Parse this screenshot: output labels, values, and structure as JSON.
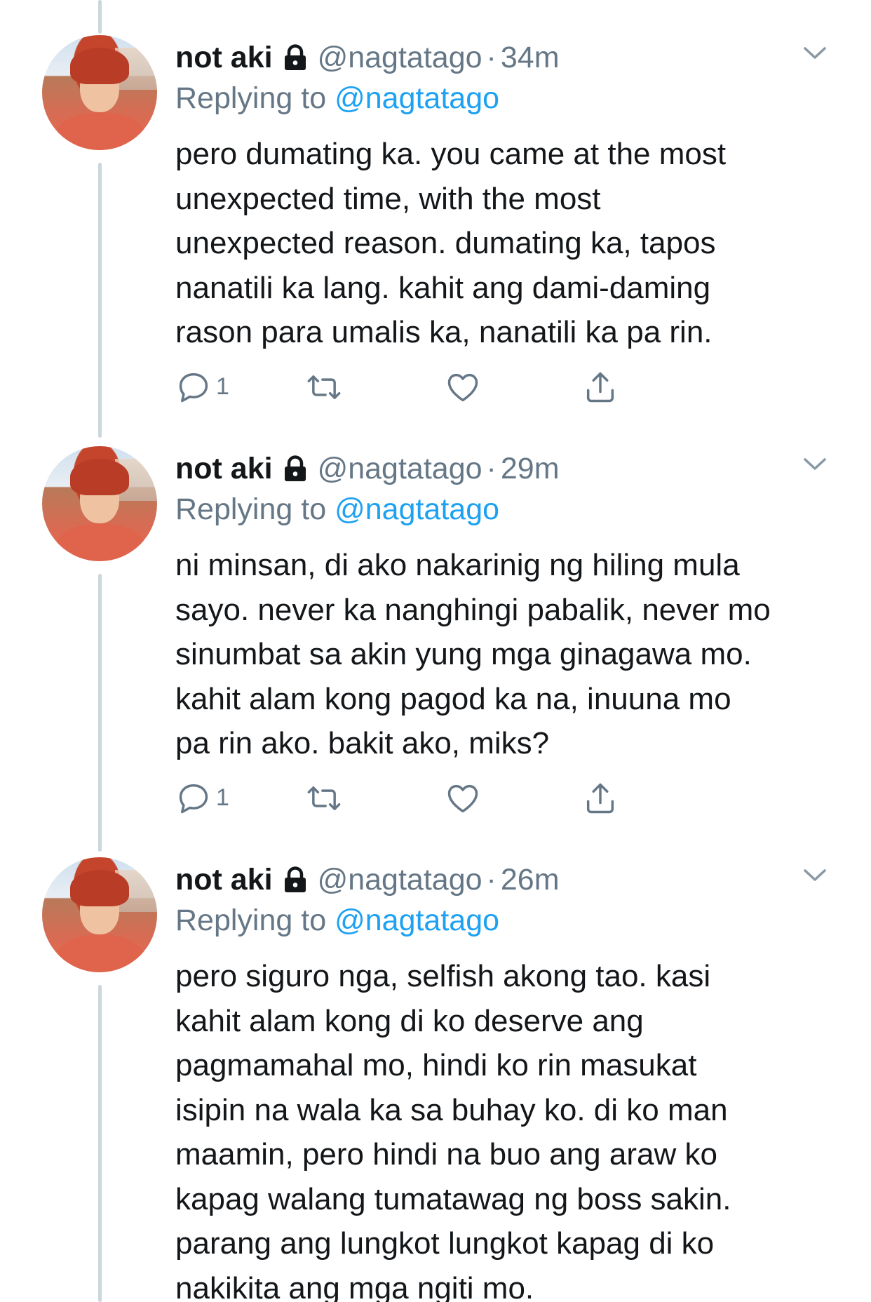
{
  "tweets": [
    {
      "name": "not aki",
      "handle": "@nagtatago",
      "separator": "·",
      "time": "34m",
      "reply_prefix": "Replying to",
      "reply_to": "@nagtatago",
      "text": "pero dumating ka. you came at the most\nunexpected time, with the most\nunexpected reason. dumating ka, tapos\nnanatili ka lang. kahit ang dami-daming\nrason para umalis ka, nanatili ka pa rin.",
      "reply_count": "1"
    },
    {
      "name": "not aki",
      "handle": "@nagtatago",
      "separator": "·",
      "time": "29m",
      "reply_prefix": "Replying to",
      "reply_to": "@nagtatago",
      "text": "ni minsan, di ako nakarinig ng hiling mula\nsayo. never ka nanghingi pabalik, never mo\nsinumbat sa akin yung mga ginagawa mo.\nkahit alam kong pagod ka na, inuuna mo\npa rin ako. bakit ako, miks?",
      "reply_count": "1"
    },
    {
      "name": "not aki",
      "handle": "@nagtatago",
      "separator": "·",
      "time": "26m",
      "reply_prefix": "Replying to",
      "reply_to": "@nagtatago",
      "text": "pero siguro nga, selfish akong tao. kasi\nkahit alam kong di ko deserve ang\npagmamahal mo, hindi ko rin masukat\nisipin na wala ka sa buhay ko. di ko man\nmaamin, pero hindi na buo ang araw ko\nkapag walang tumatawag ng boss sakin.\nparang ang lungkot lungkot kapag di ko\nnakikita ang mga ngiti mo."
    }
  ],
  "colors": {
    "text": "#14171a",
    "secondary": "#657786",
    "link": "#1da1f2",
    "thread_line": "#ccd6dd"
  },
  "icons": {
    "lock": "lock-icon",
    "chevron": "chevron-down-icon",
    "reply": "reply-icon",
    "retweet": "retweet-icon",
    "like": "heart-icon",
    "share": "share-icon"
  }
}
